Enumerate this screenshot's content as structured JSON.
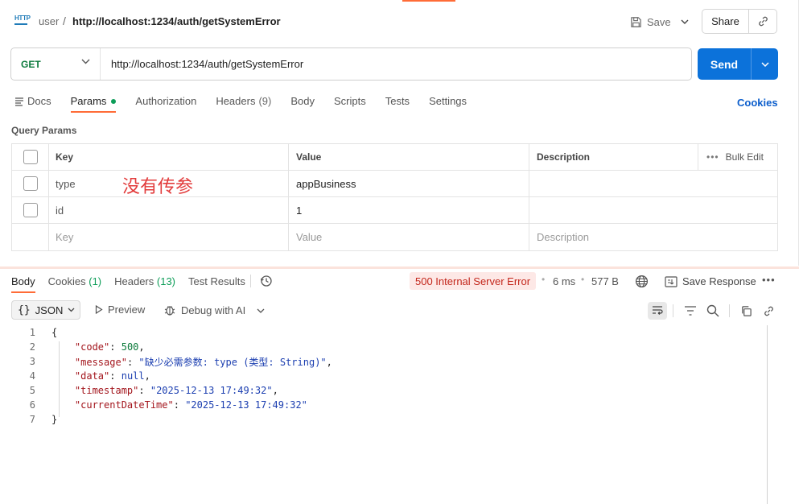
{
  "breadcrumb": {
    "collection": "user",
    "separator": "/",
    "request_name": "http://localhost:1234/auth/getSystemError",
    "http_badge": "HTTP"
  },
  "header_actions": {
    "save_label": "Save",
    "share_label": "Share"
  },
  "request": {
    "method": "GET",
    "url": "http://localhost:1234/auth/getSystemError",
    "send_label": "Send"
  },
  "request_tabs": [
    {
      "label": "Docs",
      "count": ""
    },
    {
      "label": "Params",
      "count": ""
    },
    {
      "label": "Authorization",
      "count": ""
    },
    {
      "label": "Headers",
      "count": "(9)"
    },
    {
      "label": "Body",
      "count": ""
    },
    {
      "label": "Scripts",
      "count": ""
    },
    {
      "label": "Tests",
      "count": ""
    },
    {
      "label": "Settings",
      "count": ""
    }
  ],
  "cookies_link": "Cookies",
  "query_params": {
    "section_label": "Query Params",
    "headers": {
      "key": "Key",
      "value": "Value",
      "description": "Description",
      "bulk_edit": "Bulk Edit"
    },
    "rows": [
      {
        "key": "type",
        "value": "appBusiness",
        "description": ""
      },
      {
        "key": "id",
        "value": "1",
        "description": ""
      }
    ],
    "placeholder": {
      "key": "Key",
      "value": "Value",
      "description": "Description"
    },
    "annotation": "没有传参"
  },
  "response_tabs": [
    {
      "label": "Body",
      "count": ""
    },
    {
      "label": "Cookies",
      "count": "(1)"
    },
    {
      "label": "Headers",
      "count": "(13)"
    },
    {
      "label": "Test Results",
      "count": ""
    }
  ],
  "response_meta": {
    "status": "500 Internal Server Error",
    "time": "6 ms",
    "size": "577 B",
    "save_response": "Save Response"
  },
  "response_toolbar": {
    "format": "JSON",
    "preview": "Preview",
    "debug": "Debug with AI"
  },
  "response_body": {
    "line_numbers": [
      "1",
      "2",
      "3",
      "4",
      "5",
      "6",
      "7"
    ],
    "open_brace": "{",
    "close_brace": "}",
    "fields": [
      {
        "key": "\"code\"",
        "value": "500",
        "kind": "number",
        "comma": ","
      },
      {
        "key": "\"message\"",
        "value": "\"缺少必需参数: type (类型: String)\"",
        "kind": "string",
        "comma": ","
      },
      {
        "key": "\"data\"",
        "value": "null",
        "kind": "keyword",
        "comma": ","
      },
      {
        "key": "\"timestamp\"",
        "value": "\"2025-12-13 17:49:32\"",
        "kind": "string",
        "comma": ","
      },
      {
        "key": "\"currentDateTime\"",
        "value": "\"2025-12-13 17:49:32\"",
        "kind": "string",
        "comma": ""
      }
    ]
  },
  "colors": {
    "accent": "#ff6c37",
    "send": "#0c72da",
    "method_get": "#0d7a3d",
    "error_text": "#c3261b",
    "error_bg": "#fde8e6",
    "annotation": "#e23b3b"
  }
}
